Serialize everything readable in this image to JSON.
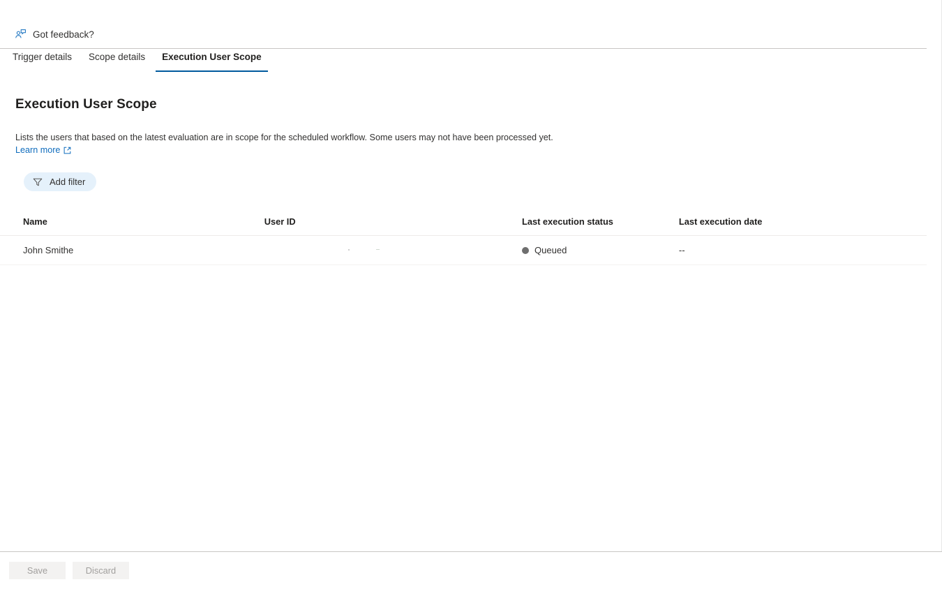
{
  "feedback": {
    "label": "Got feedback?",
    "icon": "feedback-person-icon"
  },
  "tabs": [
    {
      "label": "Trigger details",
      "active": false
    },
    {
      "label": "Scope details",
      "active": false
    },
    {
      "label": "Execution User Scope",
      "active": true
    }
  ],
  "main": {
    "title": "Execution User Scope",
    "description": "Lists the users that based on the latest evaluation are in scope for the scheduled workflow. Some users may not have been processed yet.",
    "learn_more": "Learn more",
    "learn_more_icon": "external-link-icon"
  },
  "toolbar": {
    "add_filter_label": "Add filter",
    "add_filter_icon": "funnel-icon",
    "add_filter_bg": "#e5f1fb"
  },
  "table": {
    "columns": [
      "Name",
      "User ID",
      "Last execution status",
      "Last execution date"
    ],
    "rows": [
      {
        "name": "John Smithe",
        "user_id": "",
        "status": "Queued",
        "status_color": "#6e6e6e",
        "date": "--"
      }
    ]
  },
  "footer": {
    "save_label": "Save",
    "discard_label": "Discard"
  },
  "colors": {
    "accent": "#0078d4",
    "active_tab_underline": "#005a9e",
    "link": "#0f6cbd",
    "divider": "#c8c6c4"
  }
}
